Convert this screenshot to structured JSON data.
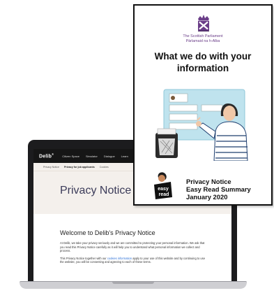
{
  "laptop": {
    "nav": {
      "logo": "Delib",
      "logo_mark": "®",
      "items": [
        "Citizen Space",
        "Simulator",
        "Dialogue",
        "Learn"
      ]
    },
    "breadcrumb": [
      "Privacy Notice",
      "Privacy for job applicants",
      "Cookies"
    ],
    "hero_title": "Privacy Notice",
    "welcome_heading": "Welcome to Delib's Privacy Notice",
    "para1": "At Delib, we take your privacy seriously and we are committed to protecting your personal information. We ask that you read this Privacy Notice carefully as it will help you to understand what personal information we collect and process.",
    "para2_before": "This Privacy Notice together with our ",
    "para2_link": "cookies information",
    "para2_after": " apply to your use of this website and by continuing to use the website, you will be consenting and agreeing to each of these terms."
  },
  "booklet": {
    "parliament_en": "The Scottish Parliament",
    "parliament_gd": "Pàrlamaid na h-Alba",
    "title_line1": "What we do with your",
    "title_line2": "information",
    "logo_text_top": "easy",
    "logo_text_bottom": "read",
    "privacy_line1": "Privacy Notice",
    "privacy_line2": "Easy Read Summary",
    "privacy_line3": "January 2020"
  },
  "colors": {
    "parliament_purple": "#6a3d88",
    "hero_bg": "#f4f0ec",
    "nav_bg": "#161616",
    "link": "#2b6fd6"
  }
}
